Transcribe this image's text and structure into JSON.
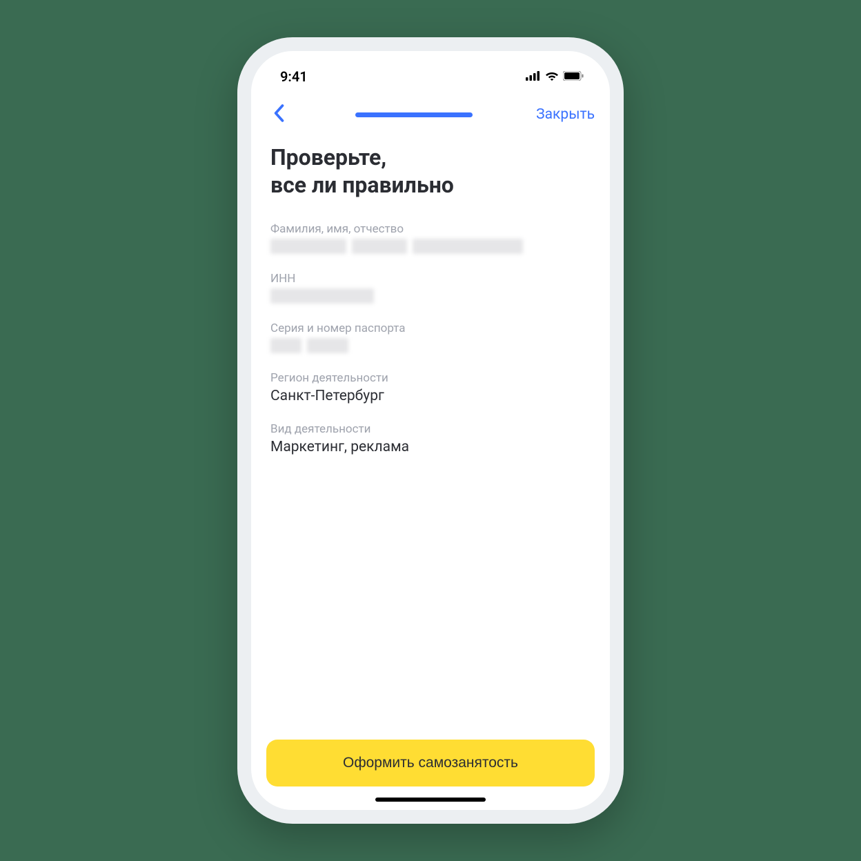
{
  "status": {
    "time": "9:41"
  },
  "nav": {
    "close_label": "Закрыть"
  },
  "title_line1": "Проверьте,",
  "title_line2": "все ли правильно",
  "fields": {
    "fullname_label": "Фамилия, имя, отчество",
    "inn_label": "ИНН",
    "passport_label": "Серия и номер паспорта",
    "region_label": "Регион деятельности",
    "region_value": "Санкт-Петербург",
    "activity_label": "Вид деятельности",
    "activity_value": "Маркетинг, реклама"
  },
  "cta_label": "Оформить самозанятость"
}
